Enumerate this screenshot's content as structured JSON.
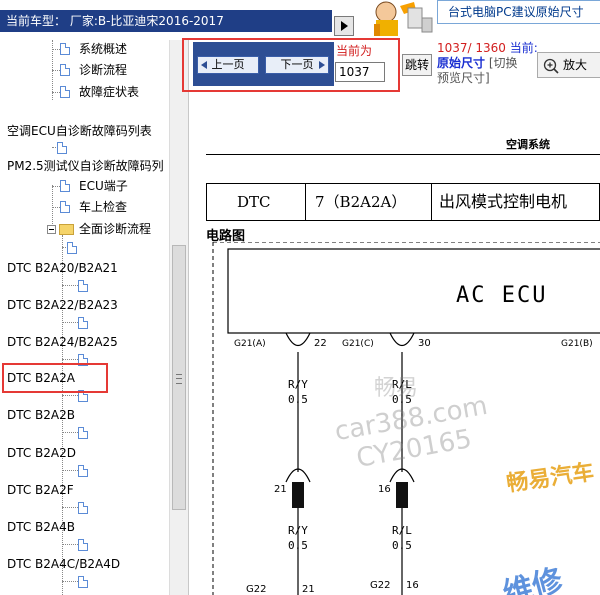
{
  "header": {
    "vehicle_label": "当前车型： 厂家:B-比亚迪宋2016-2017",
    "banner_text": "台式电脑PC建议原始尺寸"
  },
  "sidebar": {
    "items": [
      {
        "label": "系统概述",
        "type": "doc"
      },
      {
        "label": "诊断流程",
        "type": "doc"
      },
      {
        "label": "故障症状表",
        "type": "doc"
      },
      {
        "label": "空调ECU自诊断故障码列表",
        "type": "text"
      },
      {
        "label": "PM2.5测试仪自诊断故障码列",
        "type": "text"
      },
      {
        "label": "ECU端子",
        "type": "doc"
      },
      {
        "label": "车上检查",
        "type": "doc"
      },
      {
        "label": "全面诊断流程",
        "type": "folder"
      },
      {
        "label": "DTC B2A20/B2A21",
        "type": "dtc"
      },
      {
        "label": "DTC B2A22/B2A23",
        "type": "dtc"
      },
      {
        "label": "DTC B2A24/B2A25",
        "type": "dtc"
      },
      {
        "label": "DTC B2A2A",
        "type": "dtc",
        "selected": true
      },
      {
        "label": "DTC B2A2B",
        "type": "dtc"
      },
      {
        "label": "DTC B2A2D",
        "type": "dtc"
      },
      {
        "label": "DTC B2A2F",
        "type": "dtc"
      },
      {
        "label": "DTC B2A4B",
        "type": "dtc"
      },
      {
        "label": "DTC B2A4C/B2A4D",
        "type": "dtc"
      }
    ]
  },
  "toolbar": {
    "prev_label": "上一页",
    "next_label": "下一页",
    "current_label": "当前为",
    "page_value": "1037",
    "jump_label": "跳转",
    "page_count": "1037/ 1360",
    "current_suffix": "当前:",
    "size_mode": "原始尺寸",
    "switch_label": "[切换",
    "preview_label": "预览尺寸]",
    "zoom_label": "放大"
  },
  "document": {
    "section_title": "空调系统",
    "table": {
      "col1": "DTC",
      "col2": "7（B2A2A）",
      "col3": "出风模式控制电机"
    },
    "circuit_title": "电路图",
    "diagram": {
      "ecu_label": "AC ECU",
      "connector_left": "G21(A)",
      "connector_mid": "G21(C)",
      "connector_right": "G21(B)",
      "pin_left_top": "22",
      "pin_mid_top": "30",
      "wire_left": "R/Y",
      "wire_left_size": "0.5",
      "wire_mid": "R/L",
      "wire_mid_size": "0.5",
      "pin_left_join": "21",
      "pin_mid_join": "16",
      "wire_left_lower": "R/Y",
      "wire_left_lower_size": "0.5",
      "wire_mid_lower": "R/L",
      "wire_mid_lower_size": "0.5",
      "bottom_conn_left": "G22",
      "bottom_pin_left": "21",
      "bottom_conn_mid": "G22",
      "bottom_pin_mid": "16"
    },
    "watermarks": {
      "wm1": "畅易",
      "wm2": "car388.com",
      "wm3": "CY20165",
      "wm4": "畅易汽车",
      "wm5": "维修"
    }
  },
  "colors": {
    "header_bg": "#1f3e86",
    "nav_panel": "#2d4e94",
    "highlight": "#e53935",
    "red_text": "#d21e1e",
    "blue_text": "#1a2fd1"
  }
}
